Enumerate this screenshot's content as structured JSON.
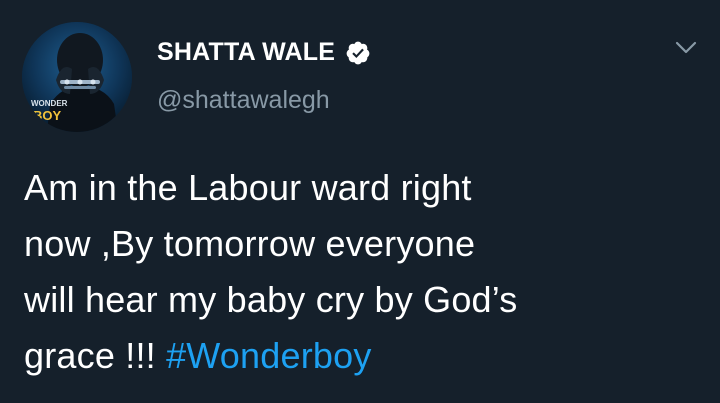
{
  "tweet": {
    "author": {
      "display_name": "SHATTA WALE",
      "handle": "@shattawalegh",
      "verified": true,
      "avatar_icon": "profile-avatar-icon",
      "avatar_text_line1": "WONDER",
      "avatar_text_line2": "BOY"
    },
    "body": {
      "line1": "Am in the Labour ward right",
      "line2": "now ,By tomorrow everyone",
      "line3": "will hear my baby cry by God’s",
      "line4_text": "grace !!! ",
      "hashtag": "#Wonderboy"
    },
    "menu_icon": "chevron-down-icon",
    "verified_icon": "verified-badge-icon"
  },
  "colors": {
    "background": "#15202b",
    "text_primary": "#ffffff",
    "text_secondary": "#8899a6",
    "link": "#1da1f2"
  }
}
